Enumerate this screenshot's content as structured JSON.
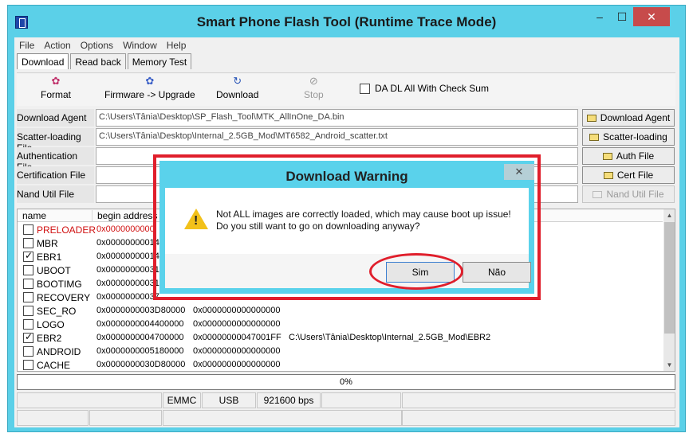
{
  "window": {
    "title": "Smart Phone Flash Tool (Runtime Trace Mode)",
    "minimize": "–",
    "maximize": "☐",
    "close": "✕"
  },
  "menu": [
    "File",
    "Action",
    "Options",
    "Window",
    "Help"
  ],
  "tabs": [
    "Download",
    "Read back",
    "Memory Test"
  ],
  "toolbar": {
    "format": "Format",
    "firmware": "Firmware -> Upgrade",
    "download": "Download",
    "stop": "Stop",
    "checksum": "DA DL All With Check Sum"
  },
  "fields": {
    "download_agent": {
      "label": "Download Agent",
      "value": "C:\\Users\\Tânia\\Desktop\\SP_Flash_Tool\\MTK_AllInOne_DA.bin",
      "button": "Download Agent"
    },
    "scatter": {
      "label": "Scatter-loading File",
      "value": "C:\\Users\\Tânia\\Desktop\\Internal_2.5GB_Mod\\MT6582_Android_scatter.txt",
      "button": "Scatter-loading"
    },
    "auth": {
      "label": "Authentication File",
      "value": "",
      "button": "Auth File"
    },
    "cert": {
      "label": "Certification File",
      "value": "",
      "button": "Cert File"
    },
    "nand": {
      "label": "Nand Util File",
      "value": "",
      "button": "Nand Util File"
    }
  },
  "list": {
    "headers": {
      "name": "name",
      "begin": "begin address"
    },
    "rows": [
      {
        "checked": false,
        "name": "PRELOADER",
        "begin": "0x0000000000",
        "end": "",
        "path": "",
        "red": true
      },
      {
        "checked": false,
        "name": "MBR",
        "begin": "0x00000000014",
        "end": "",
        "path": ""
      },
      {
        "checked": true,
        "name": "EBR1",
        "begin": "0x00000000014",
        "end": "",
        "path": ""
      },
      {
        "checked": false,
        "name": "UBOOT",
        "begin": "0x00000000031",
        "end": "",
        "path": ""
      },
      {
        "checked": false,
        "name": "BOOTIMG",
        "begin": "0x00000000031",
        "end": "",
        "path": ""
      },
      {
        "checked": false,
        "name": "RECOVERY",
        "begin": "0x00000000037",
        "end": "",
        "path": ""
      },
      {
        "checked": false,
        "name": "SEC_RO",
        "begin": "0x0000000003D80000",
        "end": "0x0000000000000000",
        "path": ""
      },
      {
        "checked": false,
        "name": "LOGO",
        "begin": "0x0000000004400000",
        "end": "0x0000000000000000",
        "path": ""
      },
      {
        "checked": true,
        "name": "EBR2",
        "begin": "0x0000000004700000",
        "end": "0x00000000047001FF",
        "path": "C:\\Users\\Tânia\\Desktop\\Internal_2.5GB_Mod\\EBR2"
      },
      {
        "checked": false,
        "name": "ANDROID",
        "begin": "0x0000000005180000",
        "end": "0x0000000000000000",
        "path": ""
      },
      {
        "checked": false,
        "name": "CACHE",
        "begin": "0x0000000030D80000",
        "end": "0x0000000000000000",
        "path": ""
      }
    ]
  },
  "progress": {
    "text": "0%"
  },
  "status": {
    "storage": "EMMC",
    "port": "USB",
    "baud": "921600 bps"
  },
  "dialog": {
    "title": "Download Warning",
    "close": "✕",
    "line1": "Not ALL images are correctly loaded, which may cause boot up issue!",
    "line2": "Do you still want to go on downloading anyway?",
    "yes": "Sim",
    "no": "Não"
  }
}
